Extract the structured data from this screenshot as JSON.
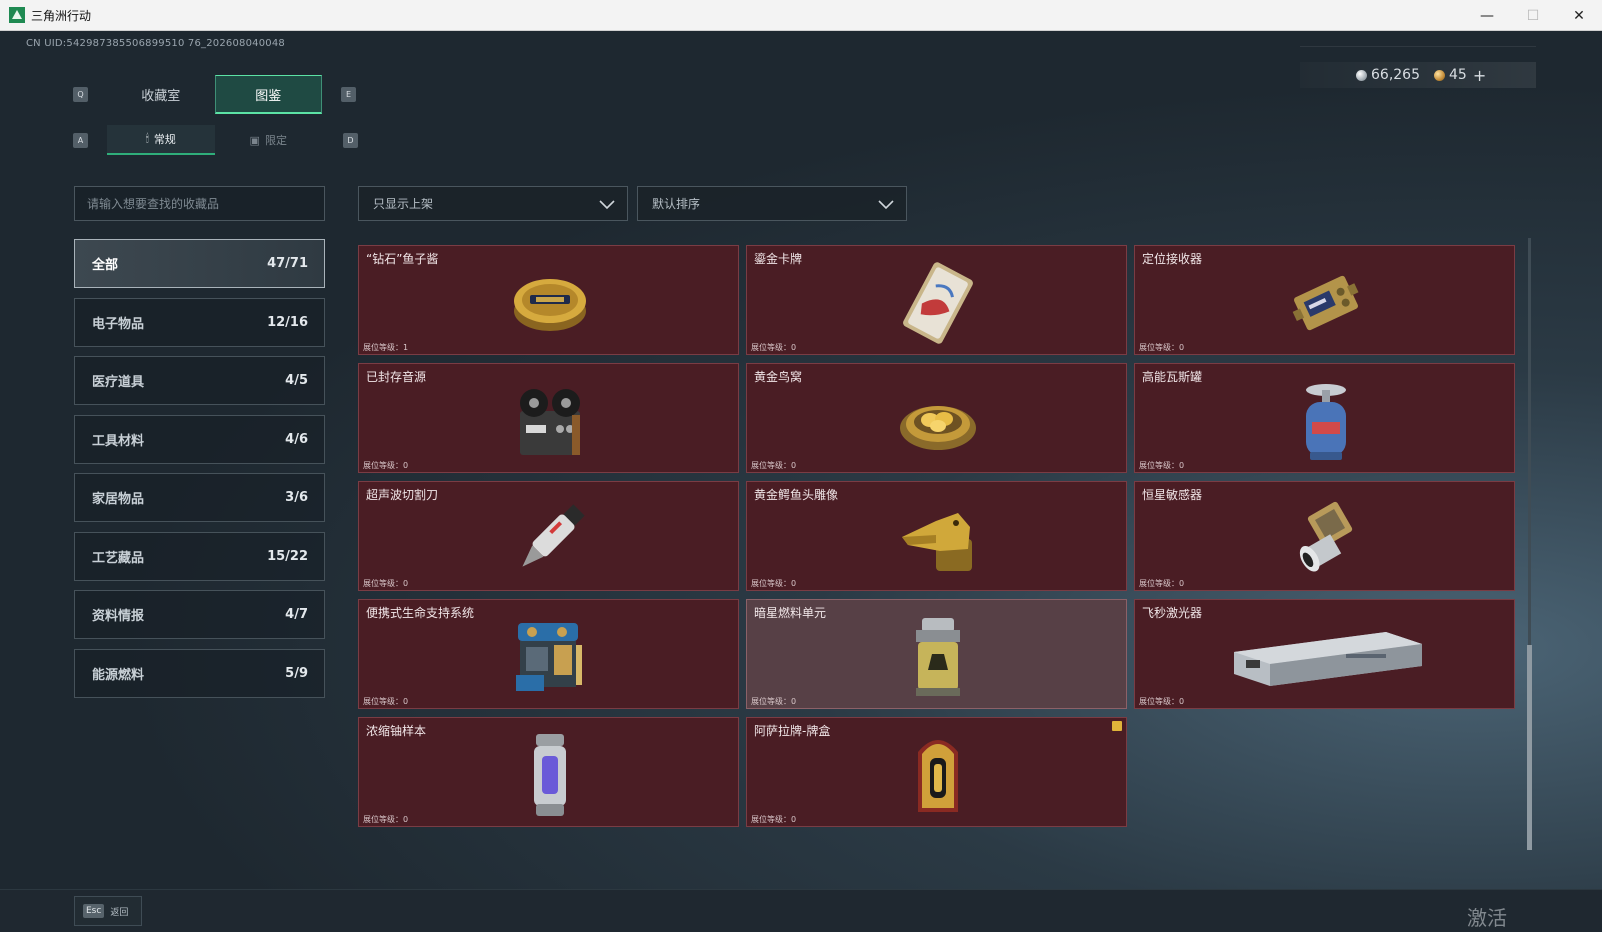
{
  "window": {
    "title": "三角洲行动",
    "controls": [
      "—",
      "☐",
      "✕"
    ]
  },
  "uid": "CN UID:542987385506899510 76_202608040048",
  "currency": {
    "silver": "66,265",
    "gold": "45",
    "add": "+"
  },
  "keys": {
    "q": "Q",
    "e": "E",
    "a": "A",
    "d": "D"
  },
  "tabs": [
    {
      "label": "收藏室",
      "active": false
    },
    {
      "label": "图鉴",
      "active": true
    }
  ],
  "subtabs": [
    {
      "label": "常规",
      "active": true,
      "icon": "🕯"
    },
    {
      "label": "限定",
      "active": false,
      "icon": "▣"
    }
  ],
  "search": {
    "placeholder": "请输入想要查找的收藏品"
  },
  "filters": {
    "shelf": "只显示上架",
    "sort": "默认排序"
  },
  "categories": [
    {
      "label": "全部",
      "count": "47/71",
      "active": true
    },
    {
      "label": "电子物品",
      "count": "12/16"
    },
    {
      "label": "医疗道具",
      "count": "4/5"
    },
    {
      "label": "工具材料",
      "count": "4/6"
    },
    {
      "label": "家居物品",
      "count": "3/6"
    },
    {
      "label": "工艺藏品",
      "count": "15/22"
    },
    {
      "label": "资料情报",
      "count": "4/7"
    },
    {
      "label": "能源燃料",
      "count": "5/9"
    }
  ],
  "level_label": "展位等级：",
  "items": [
    {
      "name": "",
      "level": "0",
      "icon": "partial-item"
    },
    {
      "name": "",
      "level": "0",
      "icon": "partial-item"
    },
    {
      "name": "",
      "level": "0",
      "icon": "partial-item"
    },
    {
      "name": "“钻石”鱼子酱",
      "level": "1",
      "icon": "caviar-tin"
    },
    {
      "name": "鎏金卡牌",
      "level": "0",
      "icon": "gold-card"
    },
    {
      "name": "定位接收器",
      "level": "0",
      "icon": "receiver"
    },
    {
      "name": "已封存音源",
      "level": "0",
      "icon": "tape-recorder"
    },
    {
      "name": "黄金鸟窝",
      "level": "0",
      "icon": "golden-nest"
    },
    {
      "name": "高能瓦斯罐",
      "level": "0",
      "icon": "gas-canister"
    },
    {
      "name": "超声波切割刀",
      "level": "0",
      "icon": "ultrasonic-cutter"
    },
    {
      "name": "黄金鳄鱼头雕像",
      "level": "0",
      "icon": "crocodile-statue"
    },
    {
      "name": "恒星敏感器",
      "level": "0",
      "icon": "star-sensor"
    },
    {
      "name": "便携式生命支持系统",
      "level": "0",
      "icon": "life-support"
    },
    {
      "name": "暗星燃料单元",
      "level": "0",
      "icon": "fuel-cell"
    },
    {
      "name": "飞秒激光器",
      "level": "0",
      "icon": "laser-box"
    },
    {
      "name": "浓缩铀样本",
      "level": "0",
      "icon": "uranium-capsule"
    },
    {
      "name": "阿萨拉牌-牌盒",
      "level": "0",
      "icon": "card-box"
    }
  ],
  "footer": {
    "key": "Esc",
    "label": "返回"
  },
  "watermark": "激活 Windows",
  "colors": {
    "accent": "#5ce3a5",
    "card": "#4a1d24",
    "card_border": "#7a3c44"
  }
}
